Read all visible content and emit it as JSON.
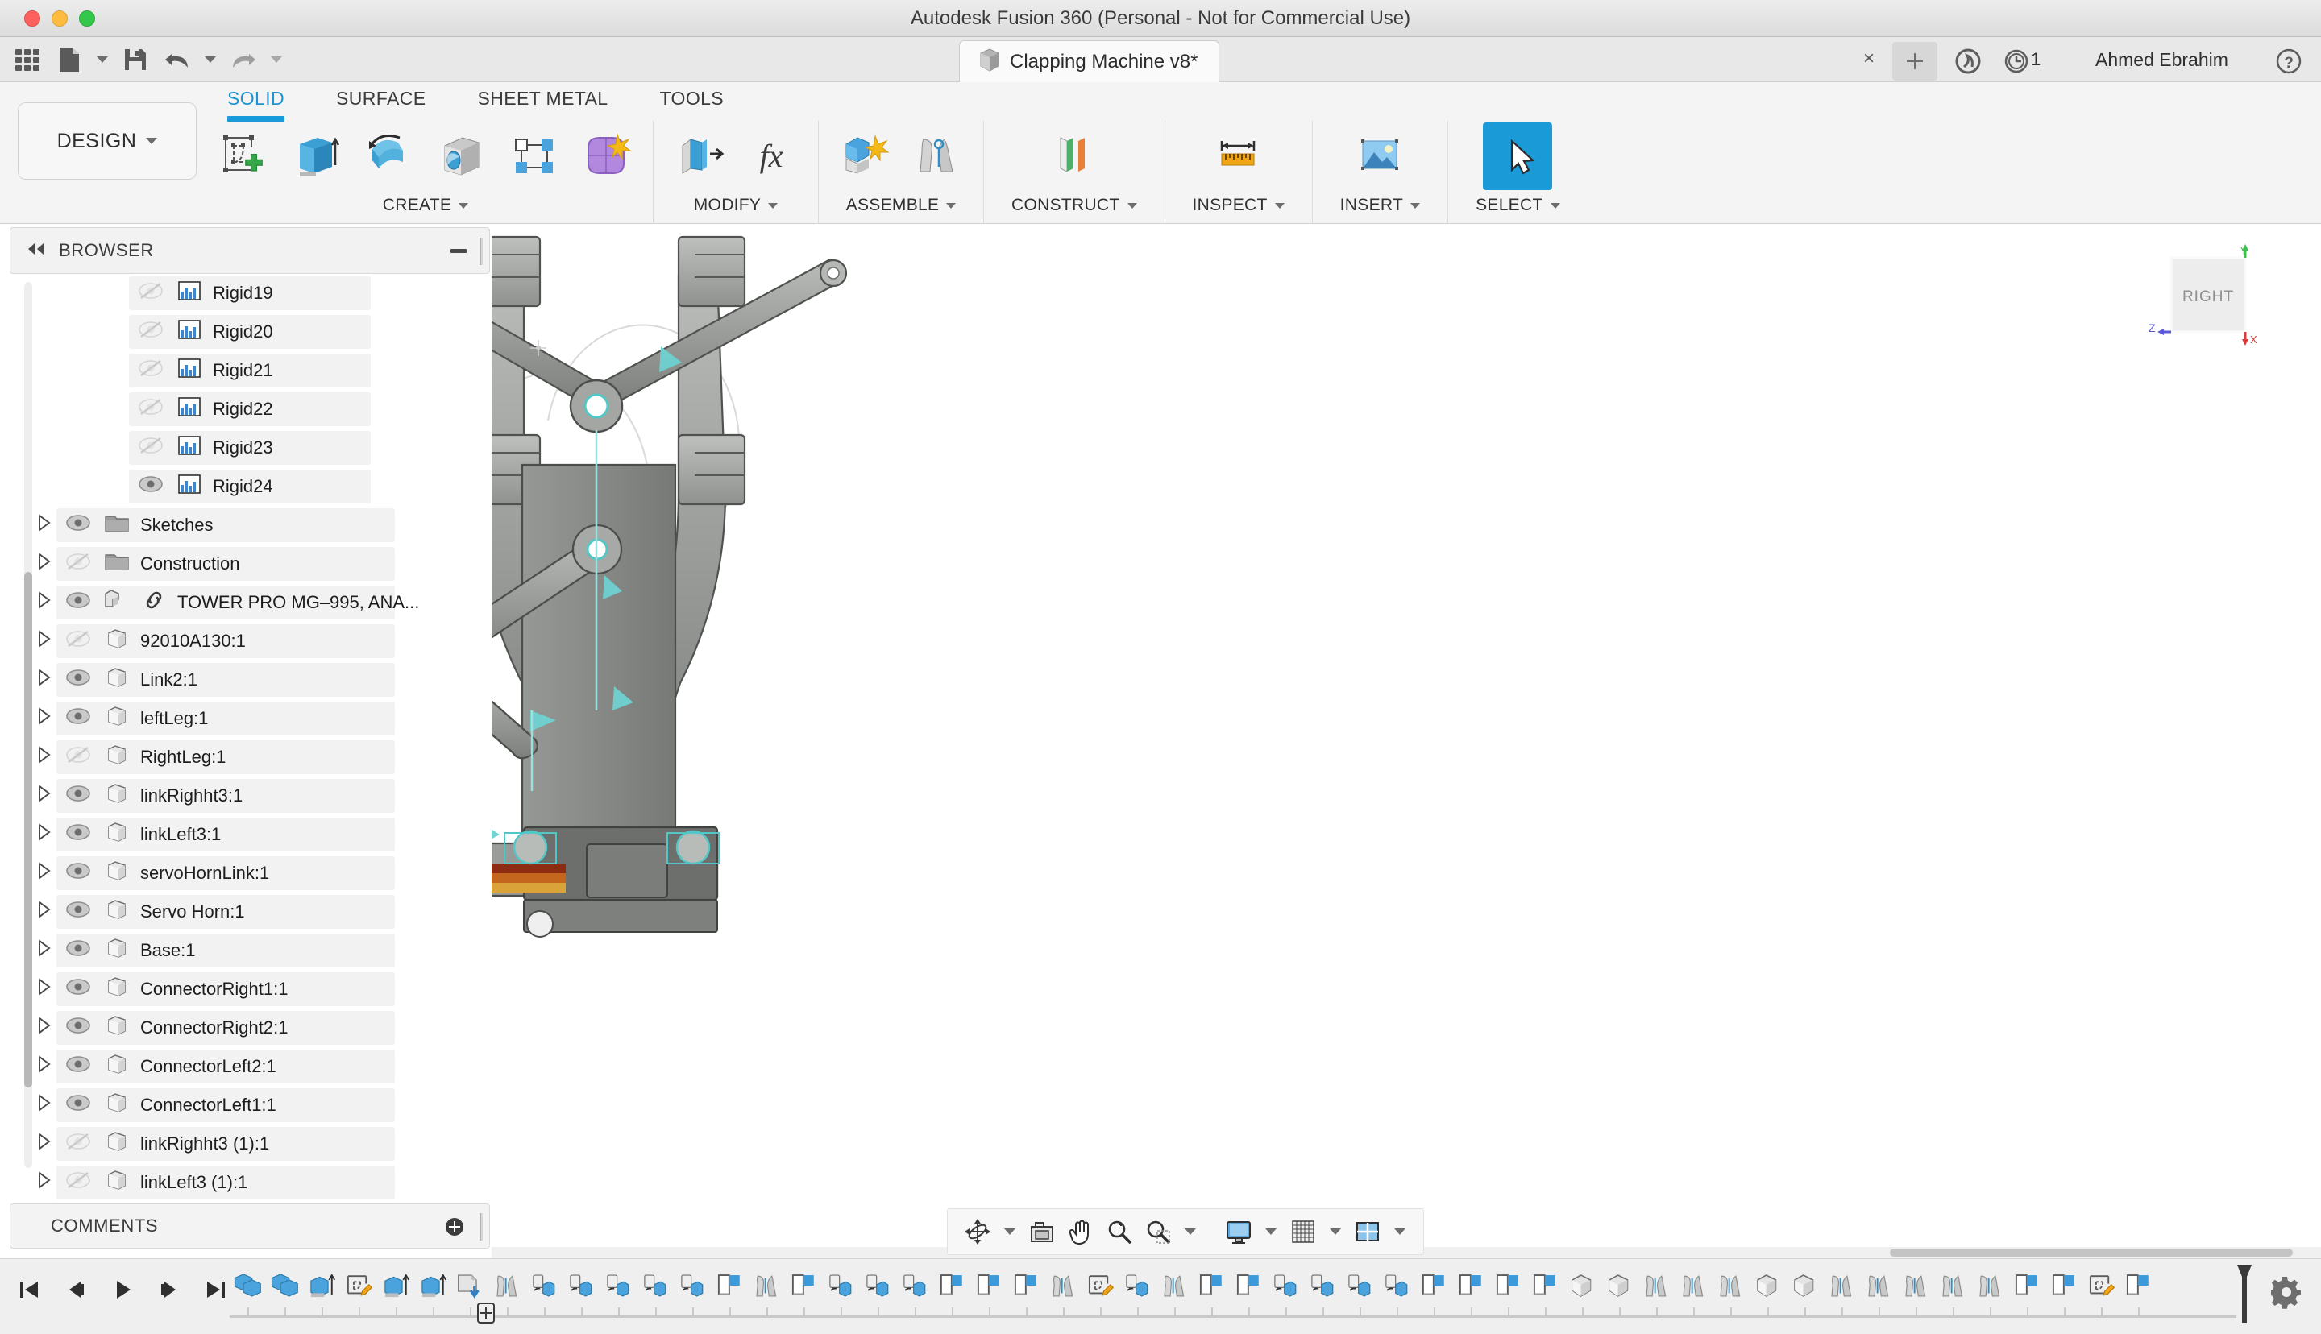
{
  "window": {
    "title": "Autodesk Fusion 360 (Personal - Not for Commercial Use)",
    "traffic_lights": [
      "close",
      "minimize",
      "maximize"
    ]
  },
  "appbar": {
    "quick_access": [
      {
        "name": "grid-apps-icon",
        "label": "Show Data Panel"
      },
      {
        "name": "new-file-icon",
        "label": "File"
      },
      {
        "name": "save-icon",
        "label": "Save"
      },
      {
        "name": "undo-icon",
        "label": "Undo"
      },
      {
        "name": "redo-icon",
        "label": "Redo"
      }
    ],
    "file_tab": {
      "name": "Clapping Machine v8*",
      "icon": "document-cube-icon"
    },
    "close_tab_label": "×",
    "new_tab_label": "+",
    "extension_icon": "extension-icon",
    "job_status_icon": "job-status-clock-icon",
    "job_count": "1",
    "user_name": "Ahmed Ebrahim",
    "help_icon": "help-icon"
  },
  "ribbon": {
    "workspace_label": "DESIGN",
    "tabs": [
      {
        "label": "SOLID",
        "active": true
      },
      {
        "label": "SURFACE",
        "active": false
      },
      {
        "label": "SHEET METAL",
        "active": false
      },
      {
        "label": "TOOLS",
        "active": false
      }
    ],
    "panels": [
      {
        "label": "CREATE",
        "has_dropdown": true,
        "buttons": [
          {
            "name": "create-sketch-icon",
            "label": "Create Sketch",
            "selected": false
          },
          {
            "name": "extrude-icon",
            "label": "Extrude",
            "selected": false
          },
          {
            "name": "revolve-icon",
            "label": "Revolve",
            "selected": false
          },
          {
            "name": "hole-icon",
            "label": "Hole",
            "selected": false
          },
          {
            "name": "rectangular-pattern-icon",
            "label": "Rectangular Pattern",
            "selected": false
          },
          {
            "name": "form-icon",
            "label": "Create Form",
            "selected": false
          }
        ]
      },
      {
        "label": "MODIFY",
        "has_dropdown": true,
        "buttons": [
          {
            "name": "press-pull-icon",
            "label": "Press Pull",
            "selected": false
          },
          {
            "name": "change-parameters-icon",
            "label": "Change Parameters",
            "selected": false
          }
        ]
      },
      {
        "label": "ASSEMBLE",
        "has_dropdown": true,
        "buttons": [
          {
            "name": "new-component-icon",
            "label": "New Component",
            "selected": false
          },
          {
            "name": "joint-icon",
            "label": "Joint",
            "selected": false
          }
        ]
      },
      {
        "label": "CONSTRUCT",
        "has_dropdown": true,
        "buttons": [
          {
            "name": "offset-plane-icon",
            "label": "Offset Plane",
            "selected": false
          }
        ]
      },
      {
        "label": "INSPECT",
        "has_dropdown": true,
        "buttons": [
          {
            "name": "measure-icon",
            "label": "Measure",
            "selected": false
          }
        ]
      },
      {
        "label": "INSERT",
        "has_dropdown": true,
        "buttons": [
          {
            "name": "insert-image-icon",
            "label": "Canvas",
            "selected": false
          }
        ]
      },
      {
        "label": "SELECT",
        "has_dropdown": true,
        "buttons": [
          {
            "name": "select-cursor-icon",
            "label": "Select",
            "selected": true
          }
        ]
      }
    ],
    "accent_color": "#1a9ad7"
  },
  "browser": {
    "title": "BROWSER",
    "collapse_icon": "collapse-left-icon",
    "items": [
      {
        "label": "Rigid19",
        "icon": "joint-rigid-icon",
        "visible": false,
        "expandable": false,
        "indent": 3
      },
      {
        "label": "Rigid20",
        "icon": "joint-rigid-icon",
        "visible": false,
        "expandable": false,
        "indent": 3
      },
      {
        "label": "Rigid21",
        "icon": "joint-rigid-icon",
        "visible": false,
        "expandable": false,
        "indent": 3
      },
      {
        "label": "Rigid22",
        "icon": "joint-rigid-icon",
        "visible": false,
        "expandable": false,
        "indent": 3
      },
      {
        "label": "Rigid23",
        "icon": "joint-rigid-icon",
        "visible": false,
        "expandable": false,
        "indent": 3
      },
      {
        "label": "Rigid24",
        "icon": "joint-rigid-icon",
        "visible": true,
        "expandable": false,
        "indent": 3
      },
      {
        "label": "Sketches",
        "icon": "folder-icon",
        "visible": true,
        "expandable": true,
        "indent": 1
      },
      {
        "label": "Construction",
        "icon": "folder-icon",
        "visible": false,
        "expandable": true,
        "indent": 1
      },
      {
        "label": "TOWER PRO MG–995, ANA...",
        "icon": "linked-component-icon",
        "visible": true,
        "expandable": true,
        "indent": 1,
        "linked": true
      },
      {
        "label": "92010A130:1",
        "icon": "component-icon",
        "visible": false,
        "expandable": true,
        "indent": 1
      },
      {
        "label": "Link2:1",
        "icon": "component-icon",
        "visible": true,
        "expandable": true,
        "indent": 1
      },
      {
        "label": "leftLeg:1",
        "icon": "component-icon",
        "visible": true,
        "expandable": true,
        "indent": 1
      },
      {
        "label": "RightLeg:1",
        "icon": "component-icon",
        "visible": false,
        "expandable": true,
        "indent": 1
      },
      {
        "label": "linkRighht3:1",
        "icon": "component-icon",
        "visible": true,
        "expandable": true,
        "indent": 1
      },
      {
        "label": "linkLeft3:1",
        "icon": "component-icon",
        "visible": true,
        "expandable": true,
        "indent": 1
      },
      {
        "label": "servoHornLink:1",
        "icon": "component-icon",
        "visible": true,
        "expandable": true,
        "indent": 1
      },
      {
        "label": "Servo Horn:1",
        "icon": "component-icon",
        "visible": true,
        "expandable": true,
        "indent": 1
      },
      {
        "label": "Base:1",
        "icon": "component-icon",
        "visible": true,
        "expandable": true,
        "indent": 1
      },
      {
        "label": "ConnectorRight1:1",
        "icon": "component-icon",
        "visible": true,
        "expandable": true,
        "indent": 1
      },
      {
        "label": "ConnectorRight2:1",
        "icon": "component-icon",
        "visible": true,
        "expandable": true,
        "indent": 1
      },
      {
        "label": "ConnectorLeft2:1",
        "icon": "component-icon",
        "visible": true,
        "expandable": true,
        "indent": 1
      },
      {
        "label": "ConnectorLeft1:1",
        "icon": "component-icon",
        "visible": true,
        "expandable": true,
        "indent": 1
      },
      {
        "label": "linkRighht3 (1):1",
        "icon": "component-icon",
        "visible": false,
        "expandable": true,
        "indent": 1
      },
      {
        "label": "linkLeft3 (1):1",
        "icon": "component-icon",
        "visible": false,
        "expandable": true,
        "indent": 1
      }
    ]
  },
  "comments": {
    "title": "COMMENTS",
    "add_icon": "add-comment-icon"
  },
  "viewport": {
    "view_cube_label": "RIGHT",
    "axis_labels": {
      "x": "X",
      "y": "Y",
      "z": "Z"
    },
    "axis_colors": {
      "x": "#e03b3b",
      "y": "#3fc04f",
      "z": "#5a5ad8"
    },
    "model_name": "Clapping Machine",
    "joint_highlight_color": "#53c6c6",
    "body_color": "#8c8f8c"
  },
  "navbar": {
    "items": [
      {
        "name": "orbit-icon",
        "label": "Orbit",
        "dropdown": true
      },
      {
        "name": "look-at-icon",
        "label": "Look At",
        "dropdown": false
      },
      {
        "name": "pan-icon",
        "label": "Pan",
        "dropdown": false
      },
      {
        "name": "zoom-icon",
        "label": "Zoom",
        "dropdown": false
      },
      {
        "name": "fit-icon",
        "label": "Fit",
        "dropdown": true
      },
      {
        "name": "display-settings-icon",
        "label": "Display Settings",
        "dropdown": true
      },
      {
        "name": "grid-snap-icon",
        "label": "Grid and Snaps",
        "dropdown": true
      },
      {
        "name": "viewports-icon",
        "label": "Viewports",
        "dropdown": true
      }
    ]
  },
  "timeline": {
    "playback": [
      {
        "name": "go-to-beginning-icon",
        "label": "Go to beginning"
      },
      {
        "name": "step-back-icon",
        "label": "Step back"
      },
      {
        "name": "play-icon",
        "label": "Play"
      },
      {
        "name": "step-forward-icon",
        "label": "Step forward"
      },
      {
        "name": "go-to-end-icon",
        "label": "Go to end"
      }
    ],
    "features": [
      {
        "type": "component",
        "name": "new-component-feature"
      },
      {
        "type": "component",
        "name": "new-component-feature"
      },
      {
        "type": "extrude",
        "name": "extrude-feature"
      },
      {
        "type": "sketch",
        "name": "sketch-feature"
      },
      {
        "type": "extrude",
        "name": "extrude-feature"
      },
      {
        "type": "extrude",
        "name": "extrude-feature"
      },
      {
        "type": "insert",
        "name": "insert-mcmaster-feature"
      },
      {
        "type": "asbuilt",
        "name": "as-built-joint-feature"
      },
      {
        "type": "rigid",
        "name": "rigid-group-feature"
      },
      {
        "type": "rigid",
        "name": "rigid-group-feature"
      },
      {
        "type": "rigid",
        "name": "rigid-group-feature"
      },
      {
        "type": "rigid",
        "name": "rigid-group-feature"
      },
      {
        "type": "rigid",
        "name": "rigid-group-feature"
      },
      {
        "type": "joint",
        "name": "joint-feature"
      },
      {
        "type": "asbuilt",
        "name": "as-built-joint-feature"
      },
      {
        "type": "joint",
        "name": "joint-feature"
      },
      {
        "type": "rigid",
        "name": "rigid-group-feature"
      },
      {
        "type": "rigid",
        "name": "rigid-group-feature"
      },
      {
        "type": "rigid",
        "name": "rigid-group-feature"
      },
      {
        "type": "joint",
        "name": "joint-feature"
      },
      {
        "type": "joint",
        "name": "joint-feature"
      },
      {
        "type": "joint",
        "name": "joint-feature"
      },
      {
        "type": "asbuilt",
        "name": "as-built-joint-feature"
      },
      {
        "type": "sketch",
        "name": "sketch-feature"
      },
      {
        "type": "rigid",
        "name": "rigid-group-feature"
      },
      {
        "type": "asbuilt",
        "name": "as-built-joint-feature"
      },
      {
        "type": "joint",
        "name": "joint-feature"
      },
      {
        "type": "joint",
        "name": "joint-feature"
      },
      {
        "type": "rigid",
        "name": "rigid-group-feature"
      },
      {
        "type": "rigid",
        "name": "rigid-group-feature"
      },
      {
        "type": "rigid",
        "name": "rigid-group-feature"
      },
      {
        "type": "rigid",
        "name": "rigid-group-feature"
      },
      {
        "type": "joint",
        "name": "joint-feature"
      },
      {
        "type": "joint",
        "name": "joint-feature"
      },
      {
        "type": "joint",
        "name": "joint-feature"
      },
      {
        "type": "joint",
        "name": "joint-feature"
      },
      {
        "type": "body",
        "name": "body-feature"
      },
      {
        "type": "body",
        "name": "body-feature"
      },
      {
        "type": "asbuilt",
        "name": "as-built-joint-feature"
      },
      {
        "type": "asbuilt",
        "name": "as-built-joint-feature"
      },
      {
        "type": "asbuilt",
        "name": "as-built-joint-feature"
      },
      {
        "type": "body",
        "name": "body-feature"
      },
      {
        "type": "body",
        "name": "body-feature"
      },
      {
        "type": "asbuilt",
        "name": "as-built-joint-feature"
      },
      {
        "type": "asbuilt",
        "name": "as-built-joint-feature"
      },
      {
        "type": "asbuilt",
        "name": "as-built-joint-feature"
      },
      {
        "type": "asbuilt",
        "name": "as-built-joint-feature"
      },
      {
        "type": "asbuilt",
        "name": "as-built-joint-feature"
      },
      {
        "type": "joint",
        "name": "joint-feature"
      },
      {
        "type": "joint",
        "name": "joint-feature"
      },
      {
        "type": "sketch",
        "name": "sketch-feature"
      },
      {
        "type": "joint",
        "name": "joint-feature"
      }
    ],
    "settings_icon": "timeline-settings-gear-icon",
    "marker_name": "timeline-end-marker"
  }
}
